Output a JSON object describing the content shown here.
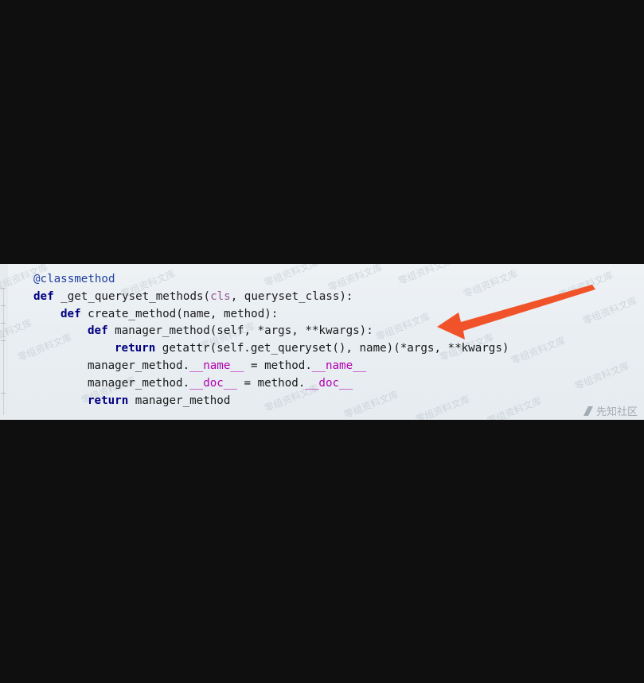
{
  "code": {
    "decorator": "@classmethod",
    "line1": {
      "kw": "def",
      "name": " _get_queryset_methods(",
      "param_cls": "cls",
      "rest": ", queryset_class):"
    },
    "line2": {
      "kw": "def",
      "rest": " create_method(name, method):"
    },
    "line3": {
      "kw": "def",
      "rest": " manager_method(self, *args, **kwargs):"
    },
    "line4": {
      "kw": "return",
      "rest": " getattr(self.get_queryset(), name)(*args, **kwargs)"
    },
    "line5": {
      "a": "manager_method.",
      "d1": "__name__",
      "b": " = method.",
      "d2": "__name__"
    },
    "line6": {
      "a": "manager_method.",
      "d1": "__doc__",
      "b": " = method.",
      "d2": "__doc__"
    },
    "line7": {
      "kw": "return",
      "rest": " manager_method"
    }
  },
  "watermark": {
    "text": "零组资料文库",
    "site": "先知社区"
  },
  "annotation": {
    "arrow_color": "#f0532a",
    "points_to": "manager_method definition"
  },
  "colors": {
    "background": "#0f0f0f",
    "keyword": "#000080",
    "decorator": "#1d3fa0",
    "cls_param": "#94558d",
    "dunder": "#b200b2"
  }
}
